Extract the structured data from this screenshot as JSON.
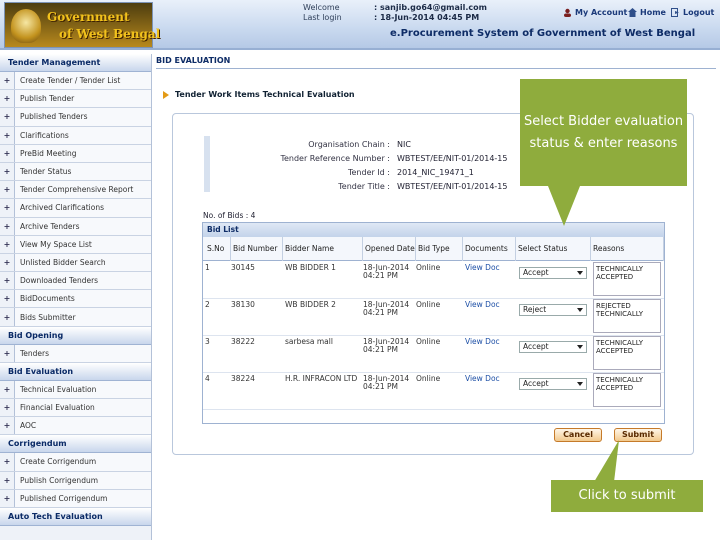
{
  "header": {
    "logo_line1": "Government",
    "logo_line2": "of West Bengal",
    "welcome_label": "Welcome",
    "welcome_value": ": sanjib.go64@gmail.com",
    "lastlogin_label": "Last login",
    "lastlogin_value": ": 18-Jun-2014 04:45 PM",
    "my_account": "My Account",
    "home": "Home",
    "logout": "Logout",
    "system_title": "e.Procurement System of Government of West Bengal"
  },
  "sidebar": {
    "sections": [
      {
        "title": "Tender Management",
        "items": [
          "Create Tender / Tender List",
          "Publish Tender",
          "Published Tenders",
          "Clarifications",
          "PreBid Meeting",
          "Tender Status",
          "Tender Comprehensive Report",
          "Archived Clarifications",
          "Archive Tenders",
          "View My Space List",
          "Unlisted Bidder Search",
          "Downloaded Tenders",
          "BidDocuments",
          "Bids Submitter"
        ]
      },
      {
        "title": "Bid Opening",
        "items": [
          "Tenders"
        ]
      },
      {
        "title": "Bid Evaluation",
        "items": [
          "Technical Evaluation",
          "Financial Evaluation",
          "AOC"
        ]
      },
      {
        "title": "Corrigendum",
        "items": [
          "Create Corrigendum",
          "Publish Corrigendum",
          "Published Corrigendum"
        ]
      },
      {
        "title": "Auto Tech Evaluation",
        "items": []
      }
    ]
  },
  "page": {
    "title": "BID EVALUATION",
    "subtitle": "Tender Work Items Technical Evaluation"
  },
  "info": {
    "org_label": "Organisation Chain :",
    "org_value": "NIC",
    "ref_label": "Tender Reference Number :",
    "ref_value": "WBTEST/EE/NIT-01/2014-15",
    "id_label": "Tender Id :",
    "id_value": "2014_NIC_19471_1",
    "title_label": "Tender Title :",
    "title_value": "WBTEST/EE/NIT-01/2014-15"
  },
  "bids": {
    "count_text": "No. of Bids : 4",
    "list_title": "Bid List",
    "headers": [
      "S.No",
      "Bid Number",
      "Bidder Name",
      "Opened Date",
      "Bid Type",
      "Documents",
      "Select Status",
      "Reasons"
    ],
    "rows": [
      {
        "sno": "1",
        "bid_number": "30145",
        "bidder": "WB BIDDER 1",
        "date": "18-Jun-2014 04:21 PM",
        "type": "Online",
        "docs": "View Doc",
        "status": "Accept",
        "reason": "TECHNICALLY ACCEPTED"
      },
      {
        "sno": "2",
        "bid_number": "38130",
        "bidder": "WB BIDDER 2",
        "date": "18-Jun-2014 04:21 PM",
        "type": "Online",
        "docs": "View Doc",
        "status": "Reject",
        "reason": "REJECTED TECHNICALLY"
      },
      {
        "sno": "3",
        "bid_number": "38222",
        "bidder": "sarbesa mall",
        "date": "18-Jun-2014 04:21 PM",
        "type": "Online",
        "docs": "View Doc",
        "status": "Accept",
        "reason": "TECHNICALLY ACCEPTED"
      },
      {
        "sno": "4",
        "bid_number": "38224",
        "bidder": "H.R. INFRACON LTD",
        "date": "18-Jun-2014 04:21 PM",
        "type": "Online",
        "docs": "View Doc",
        "status": "Accept",
        "reason": "TECHNICALLY ACCEPTED"
      }
    ]
  },
  "buttons": {
    "cancel": "Cancel",
    "submit": "Submit"
  },
  "callouts": {
    "status": "Select Bidder evaluation status & enter reasons",
    "submit": "Click to submit"
  }
}
